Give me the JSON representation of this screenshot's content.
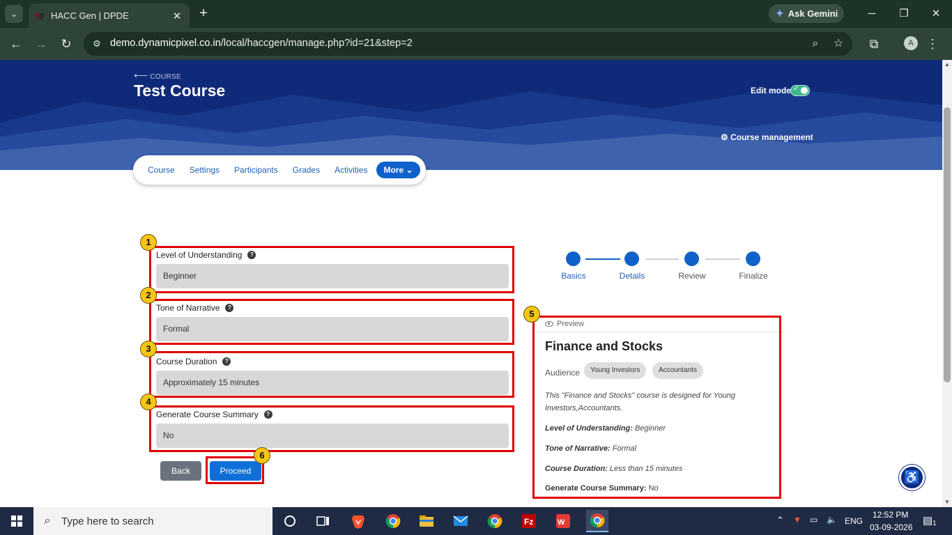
{
  "browser": {
    "tab_title": "HACC Gen | DPDE",
    "tab_close": "✕",
    "new_tab": "+",
    "gemini_label": "Ask Gemini",
    "url_host": "demo.dynamicpixel.co.in",
    "url_path": "/local/haccgen/manage.php?id=21&step=2",
    "profile_initial": "A"
  },
  "header": {
    "back_label": "COURSE",
    "course_title": "Test Course",
    "edit_mode_label": "Edit mode",
    "course_management_label": "Course management"
  },
  "course_nav": {
    "items": [
      "Course",
      "Settings",
      "Participants",
      "Grades",
      "Activities"
    ],
    "more_label": "More"
  },
  "form": {
    "fields": [
      {
        "label": "Level of Understanding",
        "value": "Beginner"
      },
      {
        "label": "Tone of Narrative",
        "value": "Formal"
      },
      {
        "label": "Course Duration",
        "value": "Approximately 15 minutes"
      },
      {
        "label": "Generate Course Summary",
        "value": "No"
      }
    ],
    "back_label": "Back",
    "proceed_label": "Proceed"
  },
  "annotations": [
    "1",
    "2",
    "3",
    "4",
    "5",
    "6"
  ],
  "stepper": {
    "steps": [
      "Basics",
      "Details",
      "Review",
      "Finalize"
    ],
    "current_step": 2
  },
  "preview": {
    "heading": "Preview",
    "title": "Finance and Stocks",
    "audience_label": "Audience",
    "audience_chips": [
      "Young Investors",
      "Accountants"
    ],
    "description": "This \"Finance and Stocks\" course is designed for Young Investors,Accountants.",
    "rows": [
      {
        "label": "Level of Understanding:",
        "value": "Beginner"
      },
      {
        "label": "Tone of Narrative:",
        "value": "Formal"
      },
      {
        "label": "Course Duration:",
        "value": "Less than 15 minutes"
      },
      {
        "label": "Generate Course Summary:",
        "value": "No"
      }
    ]
  },
  "taskbar": {
    "search_placeholder": "Type here to search",
    "language": "ENG",
    "time": "12:52 PM",
    "date": "03-09-2026",
    "notification_count": "1"
  },
  "colors": {
    "banner": "#0f2a78",
    "accent": "#0f62c9",
    "annotation_red": "#e00000",
    "annotation_badge": "#f5c518"
  }
}
